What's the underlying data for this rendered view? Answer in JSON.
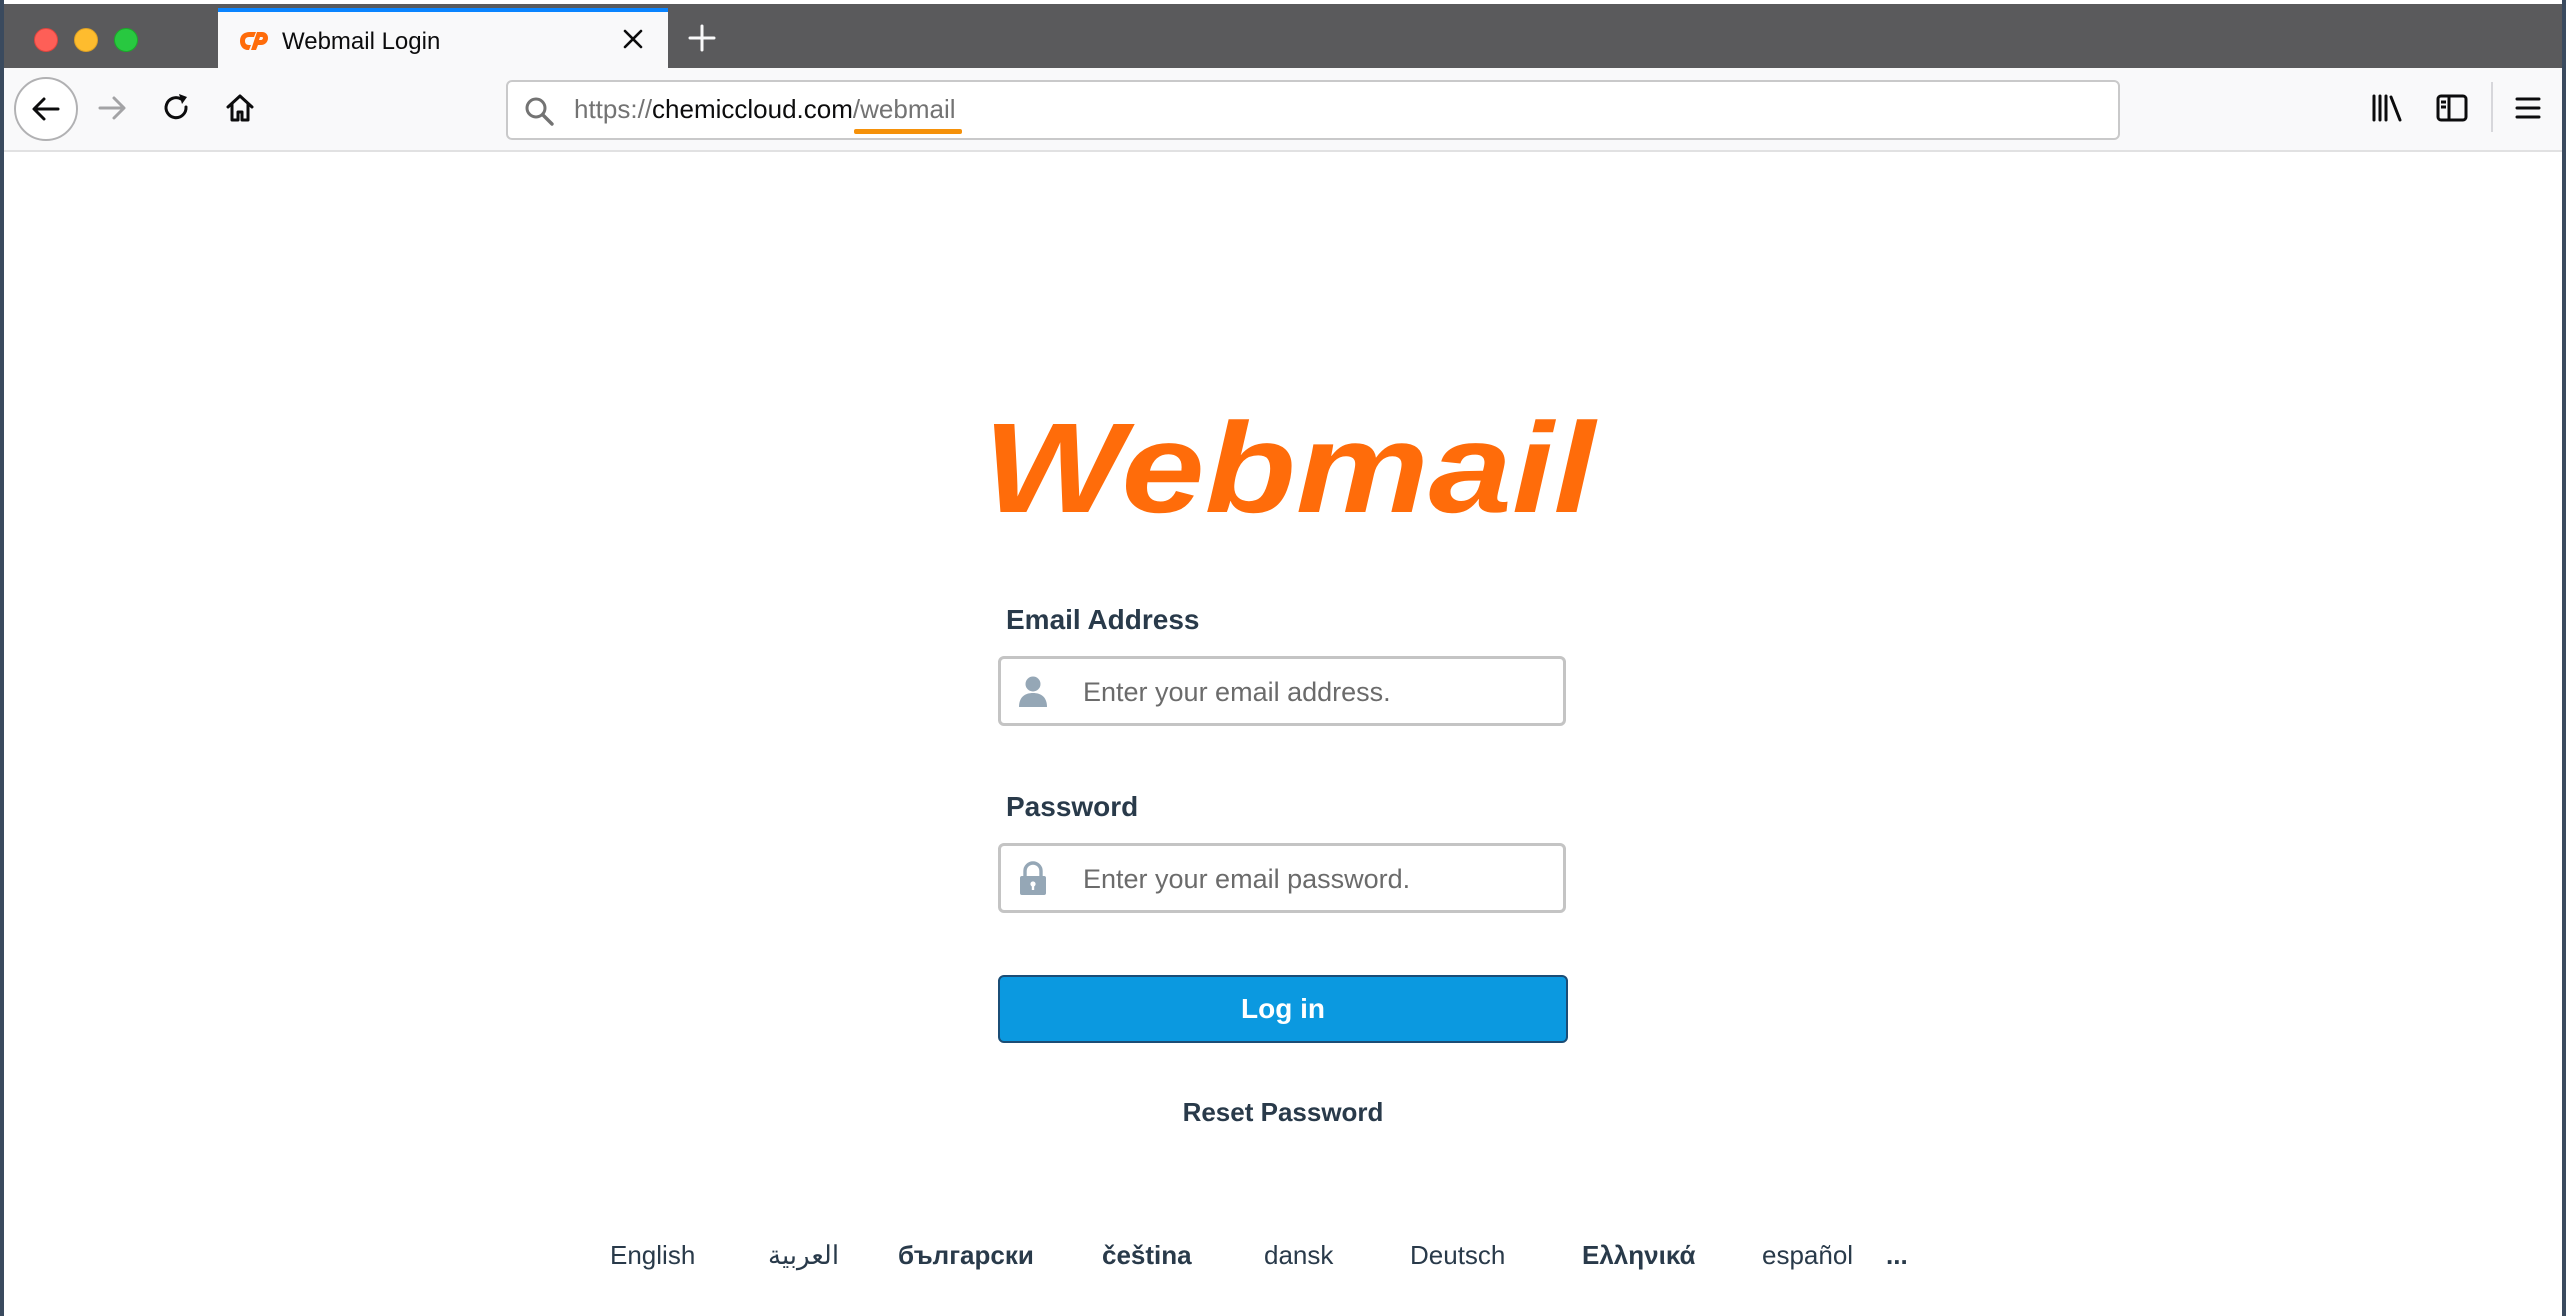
{
  "browser": {
    "tab_title": "Webmail Login",
    "url_scheme": "https://",
    "url_host": "chemiccloud.com",
    "url_sep": "/",
    "url_path": "webmail",
    "accent_color": "#0a84ff"
  },
  "page": {
    "logo_text": "Webmail",
    "logo_color": "#ff6c0a",
    "email_label": "Email Address",
    "email_placeholder": "Enter your email address.",
    "password_label": "Password",
    "password_placeholder": "Enter your email password.",
    "login_label": "Log in",
    "login_color": "#0b99e0",
    "reset_label": "Reset Password"
  },
  "languages": [
    {
      "label": "English",
      "bold": false
    },
    {
      "label": "العربية",
      "bold": false
    },
    {
      "label": "български",
      "bold": true
    },
    {
      "label": "čeština",
      "bold": true
    },
    {
      "label": "dansk",
      "bold": false
    },
    {
      "label": "Deutsch",
      "bold": false
    },
    {
      "label": "Ελληνικά",
      "bold": true
    },
    {
      "label": "español",
      "bold": false
    },
    {
      "label": "...",
      "bold": true
    }
  ]
}
